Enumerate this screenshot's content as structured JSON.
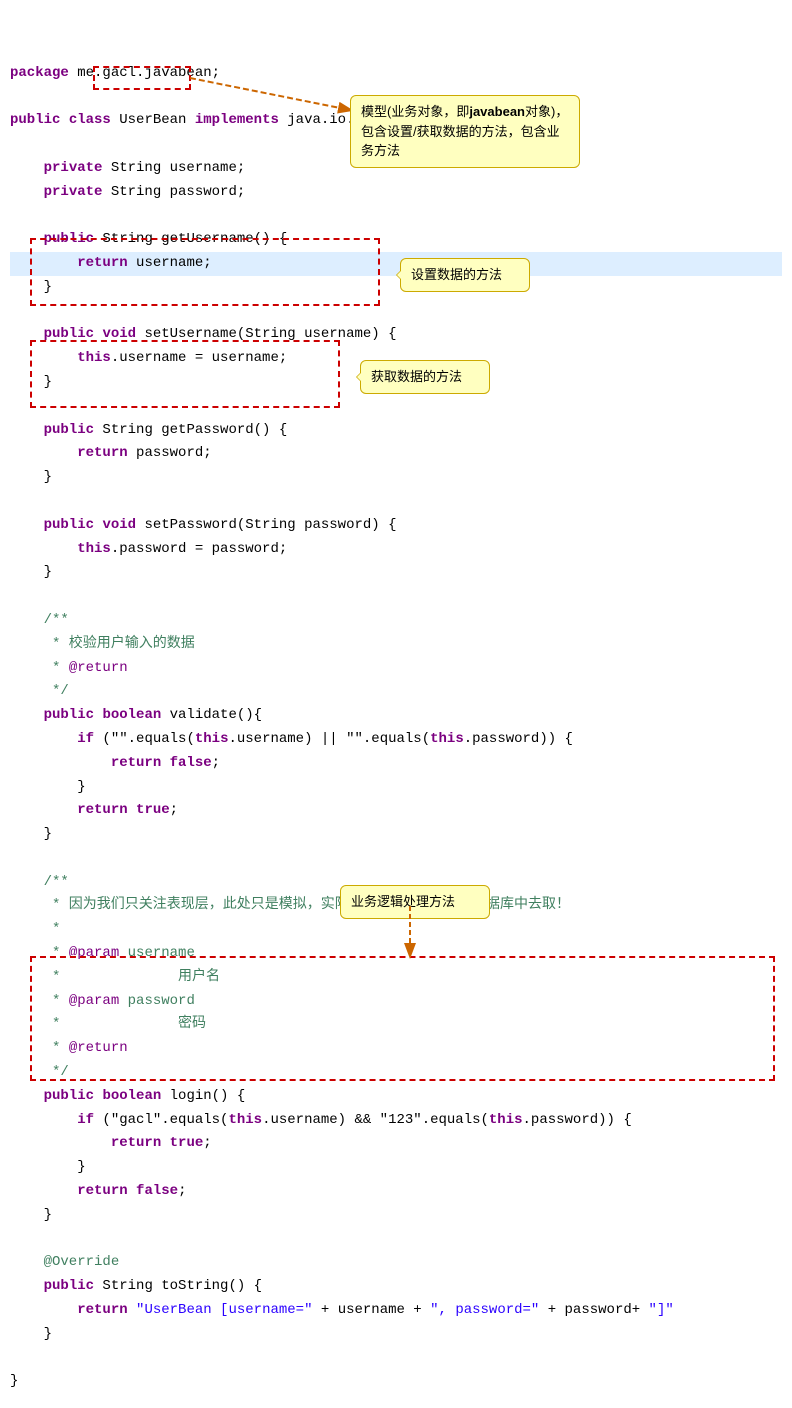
{
  "code": {
    "lines": [
      {
        "id": 1,
        "tokens": [
          {
            "text": "package",
            "cls": "kw"
          },
          {
            "text": " me.gacl.javabean;",
            "cls": "plain"
          }
        ]
      },
      {
        "id": 2,
        "tokens": []
      },
      {
        "id": 3,
        "tokens": [
          {
            "text": "public",
            "cls": "kw"
          },
          {
            "text": " ",
            "cls": "plain"
          },
          {
            "text": "class",
            "cls": "kw"
          },
          {
            "text": " UserBean ",
            "cls": "plain"
          },
          {
            "text": "implements",
            "cls": "kw"
          },
          {
            "text": " java.io.Serializable {",
            "cls": "plain"
          }
        ]
      },
      {
        "id": 4,
        "tokens": []
      },
      {
        "id": 5,
        "tokens": [
          {
            "text": "    ",
            "cls": "plain"
          },
          {
            "text": "private",
            "cls": "kw"
          },
          {
            "text": " String username;",
            "cls": "plain"
          }
        ]
      },
      {
        "id": 6,
        "tokens": [
          {
            "text": "    ",
            "cls": "plain"
          },
          {
            "text": "private",
            "cls": "kw"
          },
          {
            "text": " String password;",
            "cls": "plain"
          }
        ]
      },
      {
        "id": 7,
        "tokens": []
      },
      {
        "id": 8,
        "tokens": [
          {
            "text": "    ",
            "cls": "plain"
          },
          {
            "text": "public",
            "cls": "kw"
          },
          {
            "text": " String getUsername() {",
            "cls": "plain"
          }
        ]
      },
      {
        "id": 9,
        "tokens": [
          {
            "text": "        ",
            "cls": "plain"
          },
          {
            "text": "return",
            "cls": "kw"
          },
          {
            "text": " username;",
            "cls": "plain"
          }
        ],
        "highlight": true
      },
      {
        "id": 10,
        "tokens": [
          {
            "text": "    }",
            "cls": "plain"
          }
        ]
      },
      {
        "id": 11,
        "tokens": []
      },
      {
        "id": 12,
        "tokens": [
          {
            "text": "    ",
            "cls": "plain"
          },
          {
            "text": "public",
            "cls": "kw"
          },
          {
            "text": " ",
            "cls": "plain"
          },
          {
            "text": "void",
            "cls": "kw"
          },
          {
            "text": " setUsername(String username) {",
            "cls": "plain"
          }
        ]
      },
      {
        "id": 13,
        "tokens": [
          {
            "text": "        ",
            "cls": "plain"
          },
          {
            "text": "this",
            "cls": "kw"
          },
          {
            "text": ".username = username;",
            "cls": "plain"
          }
        ]
      },
      {
        "id": 14,
        "tokens": [
          {
            "text": "    }",
            "cls": "plain"
          }
        ]
      },
      {
        "id": 15,
        "tokens": []
      },
      {
        "id": 16,
        "tokens": [
          {
            "text": "    ",
            "cls": "plain"
          },
          {
            "text": "public",
            "cls": "kw"
          },
          {
            "text": " String getPassword() {",
            "cls": "plain"
          }
        ]
      },
      {
        "id": 17,
        "tokens": [
          {
            "text": "        ",
            "cls": "plain"
          },
          {
            "text": "return",
            "cls": "kw"
          },
          {
            "text": " password;",
            "cls": "plain"
          }
        ]
      },
      {
        "id": 18,
        "tokens": [
          {
            "text": "    }",
            "cls": "plain"
          }
        ]
      },
      {
        "id": 19,
        "tokens": []
      },
      {
        "id": 20,
        "tokens": [
          {
            "text": "    ",
            "cls": "plain"
          },
          {
            "text": "public",
            "cls": "kw"
          },
          {
            "text": " ",
            "cls": "plain"
          },
          {
            "text": "void",
            "cls": "kw"
          },
          {
            "text": " setPassword(String password) {",
            "cls": "plain"
          }
        ]
      },
      {
        "id": 21,
        "tokens": [
          {
            "text": "        ",
            "cls": "plain"
          },
          {
            "text": "this",
            "cls": "kw"
          },
          {
            "text": ".password = password;",
            "cls": "plain"
          }
        ]
      },
      {
        "id": 22,
        "tokens": [
          {
            "text": "    }",
            "cls": "plain"
          }
        ]
      },
      {
        "id": 23,
        "tokens": []
      },
      {
        "id": 24,
        "tokens": [
          {
            "text": "    /**",
            "cls": "comment"
          }
        ]
      },
      {
        "id": 25,
        "tokens": [
          {
            "text": "     * 校验用户输入的数据",
            "cls": "comment"
          }
        ]
      },
      {
        "id": 26,
        "tokens": [
          {
            "text": "     * ",
            "cls": "comment"
          },
          {
            "text": "@return",
            "cls": "javadoc-tag"
          }
        ]
      },
      {
        "id": 27,
        "tokens": [
          {
            "text": "     */",
            "cls": "comment"
          }
        ]
      },
      {
        "id": 28,
        "tokens": [
          {
            "text": "    ",
            "cls": "plain"
          },
          {
            "text": "public",
            "cls": "kw"
          },
          {
            "text": " ",
            "cls": "plain"
          },
          {
            "text": "boolean",
            "cls": "kw"
          },
          {
            "text": " validate(){",
            "cls": "plain"
          }
        ]
      },
      {
        "id": 29,
        "tokens": [
          {
            "text": "        ",
            "cls": "plain"
          },
          {
            "text": "if",
            "cls": "kw"
          },
          {
            "text": " (\"\".equals(",
            "cls": "plain"
          },
          {
            "text": "this",
            "cls": "kw"
          },
          {
            "text": ".username) || \"\".equals(",
            "cls": "plain"
          },
          {
            "text": "this",
            "cls": "kw"
          },
          {
            "text": ".password)) {",
            "cls": "plain"
          }
        ]
      },
      {
        "id": 30,
        "tokens": [
          {
            "text": "            ",
            "cls": "plain"
          },
          {
            "text": "return",
            "cls": "kw"
          },
          {
            "text": " ",
            "cls": "plain"
          },
          {
            "text": "false",
            "cls": "kw"
          },
          {
            "text": ";",
            "cls": "plain"
          }
        ]
      },
      {
        "id": 31,
        "tokens": [
          {
            "text": "        }",
            "cls": "plain"
          }
        ]
      },
      {
        "id": 32,
        "tokens": [
          {
            "text": "        ",
            "cls": "plain"
          },
          {
            "text": "return",
            "cls": "kw"
          },
          {
            "text": " ",
            "cls": "plain"
          },
          {
            "text": "true",
            "cls": "kw"
          },
          {
            "text": ";",
            "cls": "plain"
          }
        ]
      },
      {
        "id": 33,
        "tokens": [
          {
            "text": "    }",
            "cls": "plain"
          }
        ]
      },
      {
        "id": 34,
        "tokens": []
      },
      {
        "id": 35,
        "tokens": [
          {
            "text": "    /**",
            "cls": "comment"
          }
        ]
      },
      {
        "id": 36,
        "tokens": [
          {
            "text": "     * 因为我们只关注表现层，此处只是模拟，实际项目需要从写SQL从数据库中去取！",
            "cls": "comment"
          }
        ]
      },
      {
        "id": 37,
        "tokens": [
          {
            "text": "     *",
            "cls": "comment"
          }
        ]
      },
      {
        "id": 38,
        "tokens": [
          {
            "text": "     * ",
            "cls": "comment"
          },
          {
            "text": "@param",
            "cls": "javadoc-tag"
          },
          {
            "text": " username",
            "cls": "comment"
          }
        ]
      },
      {
        "id": 39,
        "tokens": [
          {
            "text": "     *              用户名",
            "cls": "comment"
          }
        ]
      },
      {
        "id": 40,
        "tokens": [
          {
            "text": "     * ",
            "cls": "comment"
          },
          {
            "text": "@param",
            "cls": "javadoc-tag"
          },
          {
            "text": " password",
            "cls": "comment"
          }
        ]
      },
      {
        "id": 41,
        "tokens": [
          {
            "text": "     *              密码",
            "cls": "comment"
          }
        ]
      },
      {
        "id": 42,
        "tokens": [
          {
            "text": "     * ",
            "cls": "comment"
          },
          {
            "text": "@return",
            "cls": "javadoc-tag"
          }
        ]
      },
      {
        "id": 43,
        "tokens": [
          {
            "text": "     */",
            "cls": "comment"
          }
        ]
      },
      {
        "id": 44,
        "tokens": [
          {
            "text": "    ",
            "cls": "plain"
          },
          {
            "text": "public",
            "cls": "kw"
          },
          {
            "text": " ",
            "cls": "plain"
          },
          {
            "text": "boolean",
            "cls": "kw"
          },
          {
            "text": " login() {",
            "cls": "plain"
          }
        ]
      },
      {
        "id": 45,
        "tokens": [
          {
            "text": "        ",
            "cls": "plain"
          },
          {
            "text": "if",
            "cls": "kw"
          },
          {
            "text": " (\"gacl\".equals(",
            "cls": "plain"
          },
          {
            "text": "this",
            "cls": "kw"
          },
          {
            "text": ".username) && \"123\".equals(",
            "cls": "plain"
          },
          {
            "text": "this",
            "cls": "kw"
          },
          {
            "text": ".password)) {",
            "cls": "plain"
          }
        ]
      },
      {
        "id": 46,
        "tokens": [
          {
            "text": "            ",
            "cls": "plain"
          },
          {
            "text": "return",
            "cls": "kw"
          },
          {
            "text": " ",
            "cls": "plain"
          },
          {
            "text": "true",
            "cls": "kw"
          },
          {
            "text": ";",
            "cls": "plain"
          }
        ]
      },
      {
        "id": 47,
        "tokens": [
          {
            "text": "        }",
            "cls": "plain"
          }
        ]
      },
      {
        "id": 48,
        "tokens": [
          {
            "text": "        ",
            "cls": "plain"
          },
          {
            "text": "return",
            "cls": "kw"
          },
          {
            "text": " ",
            "cls": "plain"
          },
          {
            "text": "false",
            "cls": "kw"
          },
          {
            "text": ";",
            "cls": "plain"
          }
        ]
      },
      {
        "id": 49,
        "tokens": [
          {
            "text": "    }",
            "cls": "plain"
          }
        ]
      },
      {
        "id": 50,
        "tokens": []
      },
      {
        "id": 51,
        "tokens": [
          {
            "text": "    @Override",
            "cls": "comment"
          }
        ]
      },
      {
        "id": 52,
        "tokens": [
          {
            "text": "    ",
            "cls": "plain"
          },
          {
            "text": "public",
            "cls": "kw"
          },
          {
            "text": " String toString() {",
            "cls": "plain"
          }
        ]
      },
      {
        "id": 53,
        "tokens": [
          {
            "text": "        ",
            "cls": "plain"
          },
          {
            "text": "return",
            "cls": "kw"
          },
          {
            "text": " ",
            "cls": "plain"
          },
          {
            "text": "\"UserBean [username=\"",
            "cls": "string"
          },
          {
            "text": " + username + ",
            "cls": "plain"
          },
          {
            "text": "\", password=\"",
            "cls": "string"
          },
          {
            "text": " + password+ ",
            "cls": "plain"
          },
          {
            "text": "\"]\"",
            "cls": "string"
          }
        ]
      },
      {
        "id": 54,
        "tokens": [
          {
            "text": "    }",
            "cls": "plain"
          }
        ]
      },
      {
        "id": 55,
        "tokens": []
      },
      {
        "id": 56,
        "tokens": [
          {
            "text": "}",
            "cls": "plain"
          }
        ]
      }
    ]
  },
  "tooltips": {
    "model": {
      "text": "模型(业务对象，即javabean对象)，包含设置/获取数据的方法，包含业务方法",
      "bold_part": "javabean"
    },
    "setter": {
      "text": "设置数据的方法"
    },
    "getter": {
      "text": "获取数据的方法"
    },
    "business": {
      "text": "业务逻辑处理方法"
    }
  }
}
